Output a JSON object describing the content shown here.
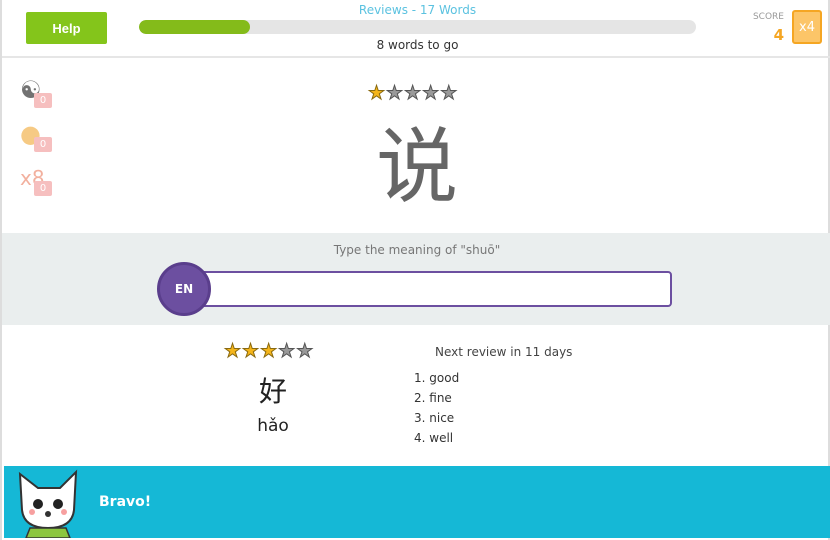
{
  "header": {
    "help_label": "Help",
    "title": "Reviews - 17 Words",
    "progress_percent": 20,
    "remaining": "8 words to go",
    "score_label": "SCORE",
    "score_value": "4",
    "multiplier": "x4"
  },
  "powerups": [
    {
      "icon": "yin-yang-icon",
      "count": "0"
    },
    {
      "icon": "paw-icon",
      "count": "0"
    },
    {
      "icon": "ribbon-icon",
      "count": "0"
    }
  ],
  "question": {
    "stars_filled": 1,
    "stars_total": 5,
    "character": "说",
    "prompt": "Type the meaning of \"shuō\"",
    "input_value": "",
    "language": "EN"
  },
  "previous": {
    "stars_filled": 3,
    "stars_total": 5,
    "character": "好",
    "pinyin": "hǎo",
    "next_review": "Next review in 11 days",
    "meanings": [
      "1. good",
      "2. fine",
      "3. nice",
      "4. well"
    ]
  },
  "footer": {
    "message": "Bravo!"
  },
  "colors": {
    "accent_green": "#84c51b",
    "purple": "#6c4fa0",
    "teal": "#15b8d6",
    "orange": "#f5a623"
  }
}
